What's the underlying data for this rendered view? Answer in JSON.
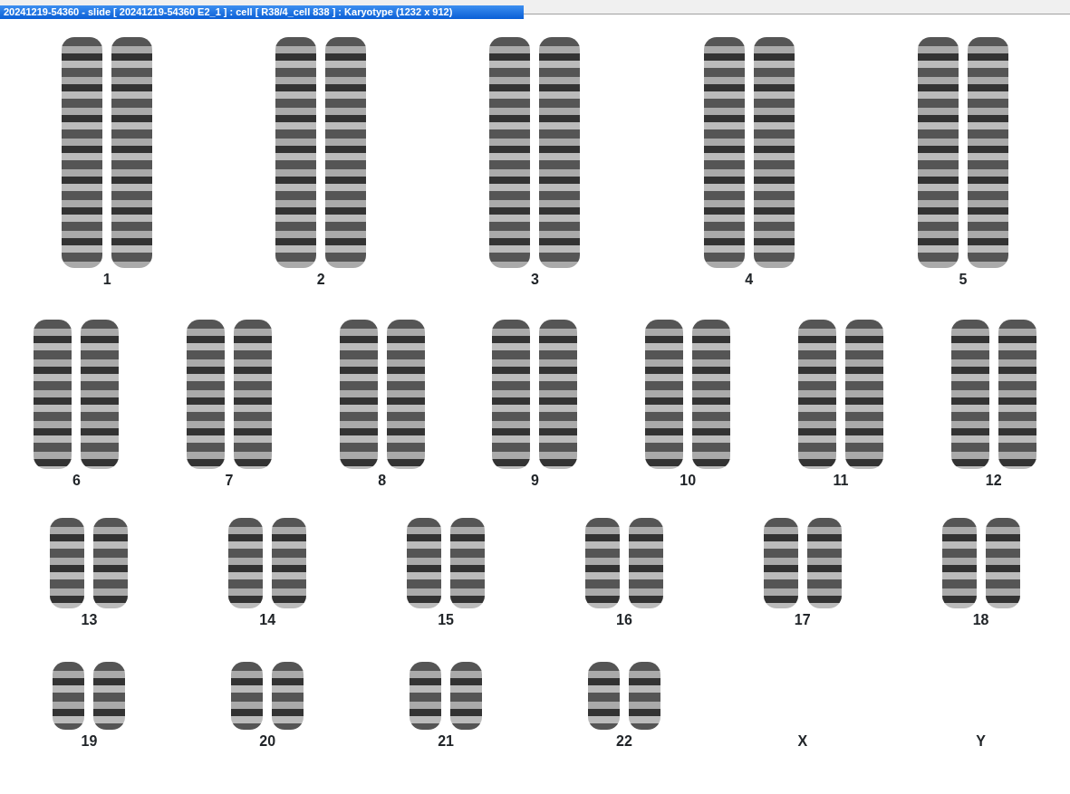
{
  "window": {
    "title": "20241219-54360 - slide [ 20241219-54360 E2_1 ] : cell [ R38/4_cell 838 ] : Karyotype  (1232 x 912)"
  },
  "karyotype": {
    "rows": [
      [
        {
          "label": "1",
          "kind": "pair"
        },
        {
          "label": "2",
          "kind": "pair"
        },
        {
          "label": "3",
          "kind": "pair"
        },
        {
          "label": "4",
          "kind": "pair"
        },
        {
          "label": "5",
          "kind": "pair"
        }
      ],
      [
        {
          "label": "6",
          "kind": "pair"
        },
        {
          "label": "7",
          "kind": "pair"
        },
        {
          "label": "8",
          "kind": "pair"
        },
        {
          "label": "9",
          "kind": "pair"
        },
        {
          "label": "10",
          "kind": "pair"
        },
        {
          "label": "11",
          "kind": "pair"
        },
        {
          "label": "12",
          "kind": "pair"
        }
      ],
      [
        {
          "label": "13",
          "kind": "pair"
        },
        {
          "label": "14",
          "kind": "pair"
        },
        {
          "label": "15",
          "kind": "pair"
        },
        {
          "label": "16",
          "kind": "pair"
        },
        {
          "label": "17",
          "kind": "pair"
        },
        {
          "label": "18",
          "kind": "pair"
        }
      ],
      [
        {
          "label": "19",
          "kind": "pair"
        },
        {
          "label": "20",
          "kind": "pair"
        },
        {
          "label": "21",
          "kind": "pair"
        },
        {
          "label": "22",
          "kind": "pair"
        },
        {
          "label": "X",
          "kind": "empty"
        },
        {
          "label": "Y",
          "kind": "empty"
        }
      ]
    ]
  }
}
